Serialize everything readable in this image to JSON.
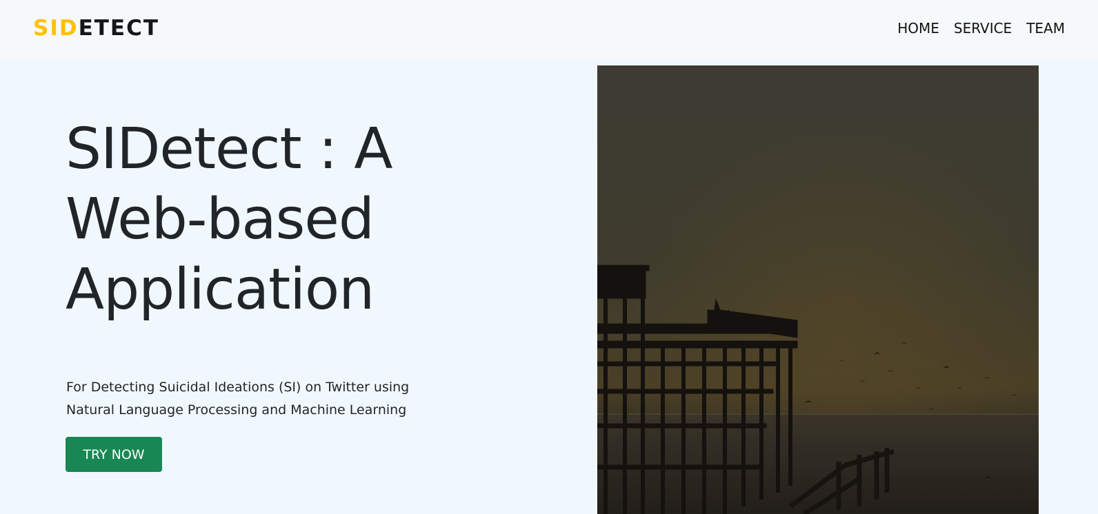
{
  "brand": {
    "accent": "SID",
    "rest": "ETECT"
  },
  "nav": {
    "items": [
      {
        "label": "HOME"
      },
      {
        "label": "SERVICE"
      },
      {
        "label": "TEAM"
      }
    ]
  },
  "hero": {
    "title_lines": [
      "SIDetect : A",
      "Web-based",
      "Application"
    ],
    "subtitle_lines": [
      "For Detecting Suicidal Ideations (SI) on Twitter using",
      "Natural Language Processing and Machine Learning"
    ],
    "cta_label": "TRY NOW",
    "image": {
      "subject": "dark photo of a ruined pier over the sea with birds"
    }
  },
  "colors": {
    "brand_accent": "#ffc107",
    "cta_background": "#198754",
    "page_background": "#f1f8fd",
    "navbar_background": "#f6f8fa"
  }
}
